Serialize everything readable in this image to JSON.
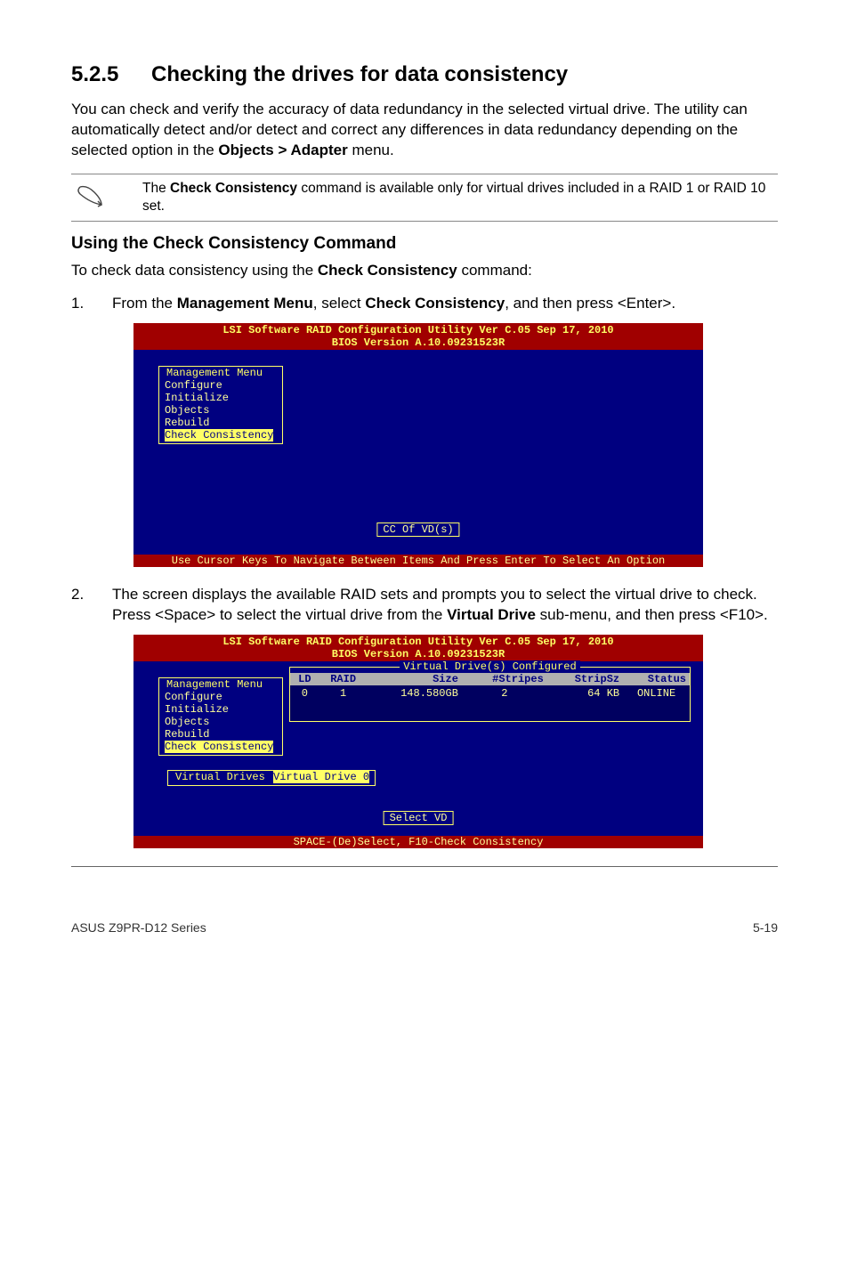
{
  "section": {
    "number": "5.2.5",
    "title": "Checking the drives for data consistency"
  },
  "intro": {
    "text_pre": "You can check and verify the accuracy of data redundancy in the selected virtual drive. The utility can automatically detect and/or detect and correct any differences in data redundancy depending on the selected option in the ",
    "bold1": "Objects > Adapter",
    "text_post": " menu."
  },
  "note": {
    "pre": "The ",
    "bold": "Check Consistency",
    "post": " command is available only for virtual drives included in a RAID 1 or RAID 10 set."
  },
  "subhead": "Using the Check Consistency Command",
  "lead": {
    "pre": "To check data consistency using the ",
    "bold": "Check Consistency",
    "post": " command:"
  },
  "steps": {
    "s1": {
      "num": "1.",
      "pre": "From the ",
      "b1": "Management Menu",
      "mid": ", select ",
      "b2": "Check Consistency",
      "post": ", and then press <Enter>."
    },
    "s2": {
      "num": "2.",
      "pre": "The screen displays the available RAID sets and prompts you to select the virtual drive to check. Press <Space> to select the virtual drive from the ",
      "b1": "Virtual Drive",
      "post": " sub-menu, and then press <F10>."
    }
  },
  "bios": {
    "top_line1": "LSI Software RAID Configuration Utility Ver C.05 Sep 17, 2010",
    "top_line2": "BIOS Version   A.10.09231523R",
    "management_menu_title": "Management Menu",
    "menu_items": {
      "configure": "Configure",
      "initialize": "Initialize",
      "objects": "Objects",
      "rebuild": "Rebuild",
      "check_consistency": "Check Consistency"
    },
    "status1": "CC Of VD(s)",
    "bottom1": "Use Cursor Keys To Navigate Between Items And Press Enter To Select An Option",
    "vd_table_title": "Virtual Drive(s) Configured",
    "vd_headers": {
      "ld": "LD",
      "raid": "RAID",
      "size": "Size",
      "stripes": "#Stripes",
      "stripsz": "StripSz",
      "status": "Status"
    },
    "vd_row": {
      "ld": "0",
      "raid": "1",
      "size": "148.580GB",
      "stripes": "2",
      "stripsz": "64 KB",
      "status": "ONLINE"
    },
    "virtual_drives_title": "Virtual Drives",
    "virtual_drive_0": "Virtual Drive 0",
    "status2": "Select VD",
    "bottom2": "SPACE-(De)Select,    F10-Check Consistency"
  },
  "footer": {
    "left": "ASUS Z9PR-D12 Series",
    "right": "5-19"
  }
}
